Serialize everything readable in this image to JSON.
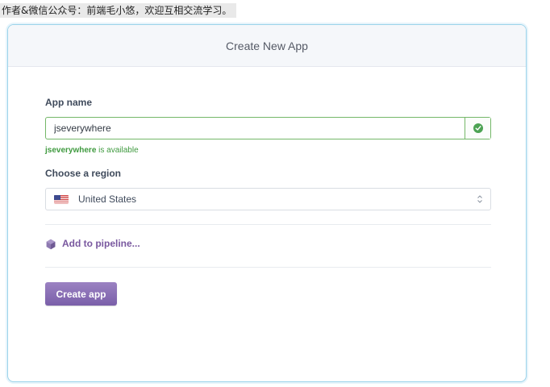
{
  "watermark": {
    "text": "作者&微信公众号：前端毛小悠，欢迎互相交流学习。"
  },
  "dialog": {
    "title": "Create New App",
    "app_name_label": "App name",
    "app_name_value": "jseverywhere",
    "availability": {
      "name": "jseverywhere",
      "status_text": " is available"
    },
    "region_label": "Choose a region",
    "region_value": "United States",
    "pipeline_label": "Add to pipeline...",
    "create_button_label": "Create app"
  },
  "icons": {
    "valid": "check-circle-icon",
    "flag": "us-flag-icon",
    "select_arrows": "updown-arrows-icon",
    "pipeline": "pipeline-hexagon-icon"
  },
  "colors": {
    "accent_purple": "#79589f",
    "success_green": "#4ca353",
    "card_border": "#9bd3ea"
  }
}
